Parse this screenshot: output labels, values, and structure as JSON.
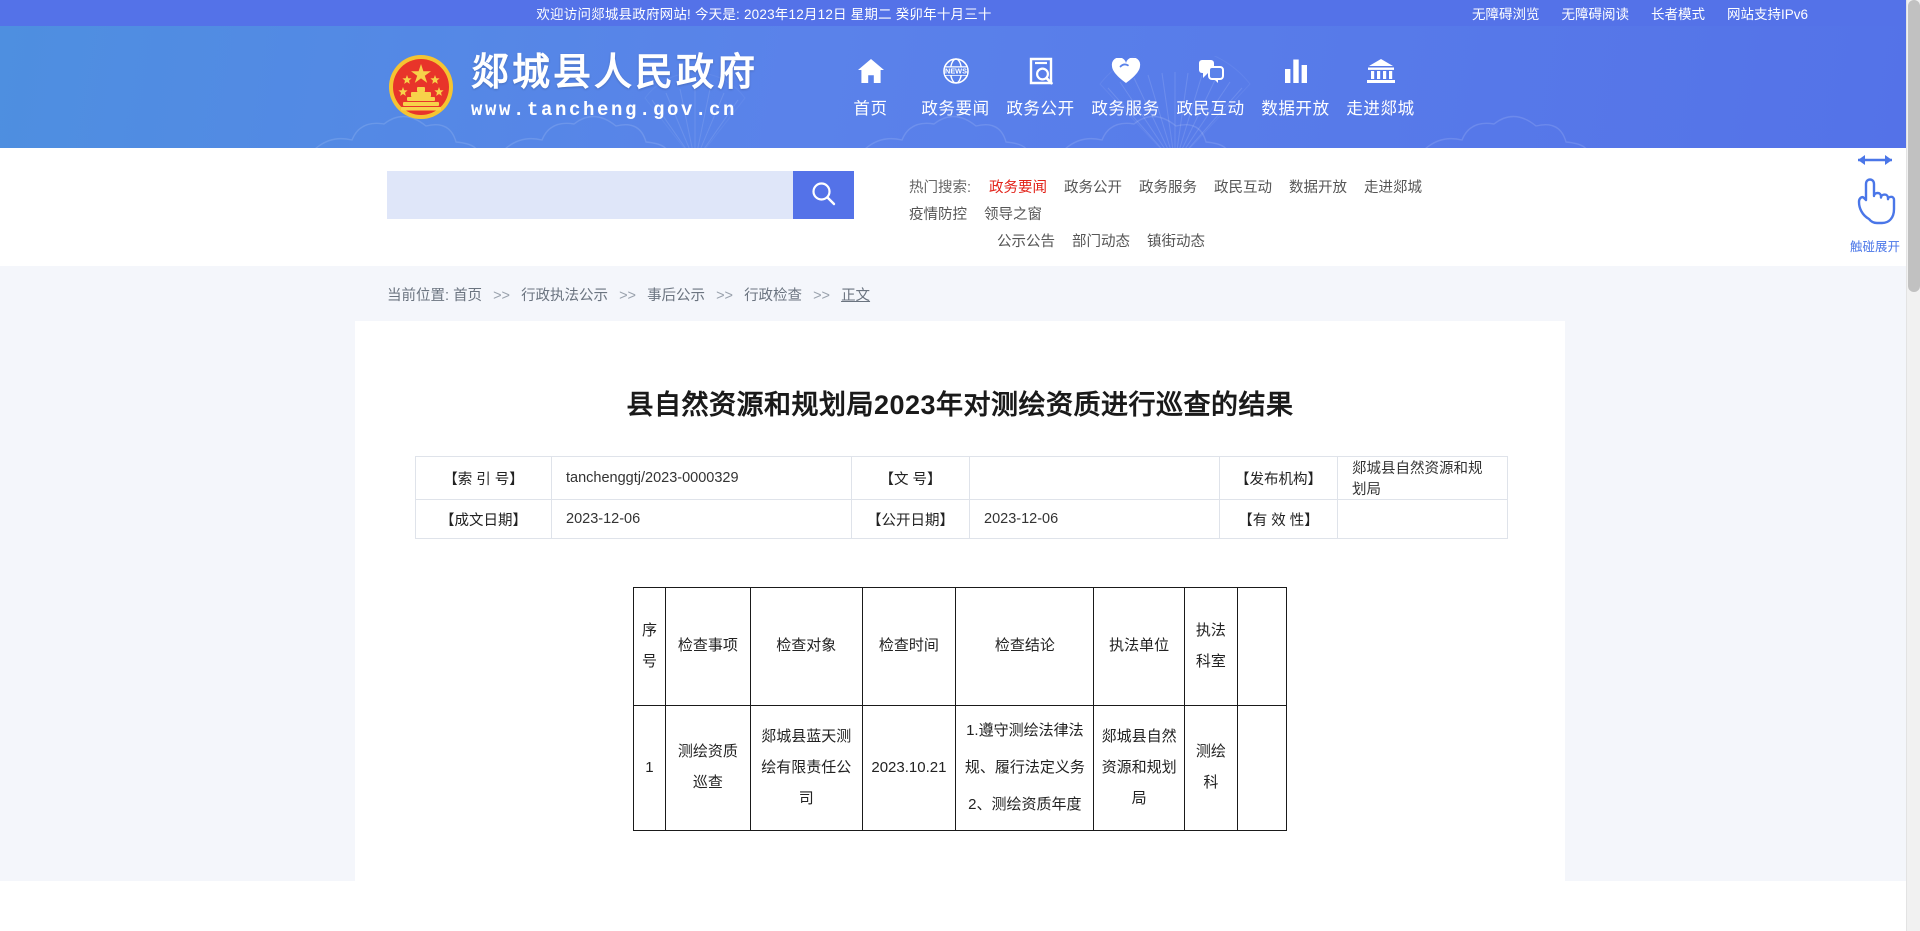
{
  "topbar": {
    "welcome": "欢迎访问郯城县政府网站! 今天是: 2023年12月12日  星期二  癸卯年十月三十",
    "links": [
      "无障碍浏览",
      "无障碍阅读",
      "长者模式",
      "网站支持IPv6"
    ]
  },
  "brand": {
    "title": "郯城县人民政府",
    "url": "www.tancheng.gov.cn",
    "emblem_icon": "national-emblem-icon"
  },
  "nav": [
    {
      "label": "首页",
      "icon": "home-icon"
    },
    {
      "label": "政务要闻",
      "icon": "news-globe-icon"
    },
    {
      "label": "政务公开",
      "icon": "document-search-icon"
    },
    {
      "label": "政务服务",
      "icon": "heart-hand-icon"
    },
    {
      "label": "政民互动",
      "icon": "chat-bubble-icon"
    },
    {
      "label": "数据开放",
      "icon": "bar-chart-icon"
    },
    {
      "label": "走进郯城",
      "icon": "landmark-icon"
    }
  ],
  "search": {
    "value": "",
    "placeholder": "",
    "button_icon": "search-icon"
  },
  "hot_search": {
    "label": "热门搜索:",
    "items": [
      {
        "text": "政务要闻",
        "active": true
      },
      {
        "text": "政务公开",
        "active": false
      },
      {
        "text": "政务服务",
        "active": false
      },
      {
        "text": "政民互动",
        "active": false
      },
      {
        "text": "数据开放",
        "active": false
      },
      {
        "text": "走进郯城",
        "active": false
      },
      {
        "text": "疫情防控",
        "active": false
      },
      {
        "text": "领导之窗",
        "active": false
      },
      {
        "text": "公示公告",
        "active": false
      },
      {
        "text": "部门动态",
        "active": false
      },
      {
        "text": "镇街动态",
        "active": false
      }
    ]
  },
  "breadcrumb": {
    "prefix": "当前位置:",
    "items": [
      "首页",
      "行政执法公示",
      "事后公示",
      "行政检查",
      "正文"
    ],
    "separator": ">>"
  },
  "article": {
    "title": "县自然资源和规划局2023年对测绘资质进行巡查的结果"
  },
  "meta_table": {
    "rows": [
      [
        {
          "key": "【索 引 号】",
          "value": "tanchenggtj/2023-0000329"
        },
        {
          "key": "【文       号】",
          "value": ""
        },
        {
          "key": "【发布机构】",
          "value": "郯城县自然资源和规划局"
        }
      ],
      [
        {
          "key": "【成文日期】",
          "value": "2023-12-06"
        },
        {
          "key": "【公开日期】",
          "value": "2023-12-06"
        },
        {
          "key": "【有 效 性】",
          "value": ""
        }
      ]
    ]
  },
  "content_table": {
    "headers": [
      "序号",
      "检查事项",
      "检查对象",
      "检查时间",
      "检查结论",
      "执法单位",
      "执法科室",
      ""
    ],
    "rows": [
      {
        "no": "1",
        "item": "测绘资质巡查",
        "object": "郯城县蓝天测绘有限责任公司",
        "time": "2023.10.21",
        "conclusion_lines": [
          "1.遵守测绘法律法规、履行法定义务",
          "2、测绘资质年度"
        ],
        "unit": "郯城县自然资源和规划局",
        "dept": "测绘科",
        "extra": ""
      }
    ]
  },
  "floater": {
    "label": "触碰展开",
    "icon": "hand-pointer-icon",
    "arrow_icon": "left-right-arrow-icon",
    "accent": "#4a76e8"
  },
  "colors": {
    "brand_blue": "#5472e8",
    "header_gradient_start": "#4e8fe0",
    "search_field": "#dfe6f9",
    "page_bg": "#f4f6fb",
    "accent_red": "#e2231a"
  }
}
